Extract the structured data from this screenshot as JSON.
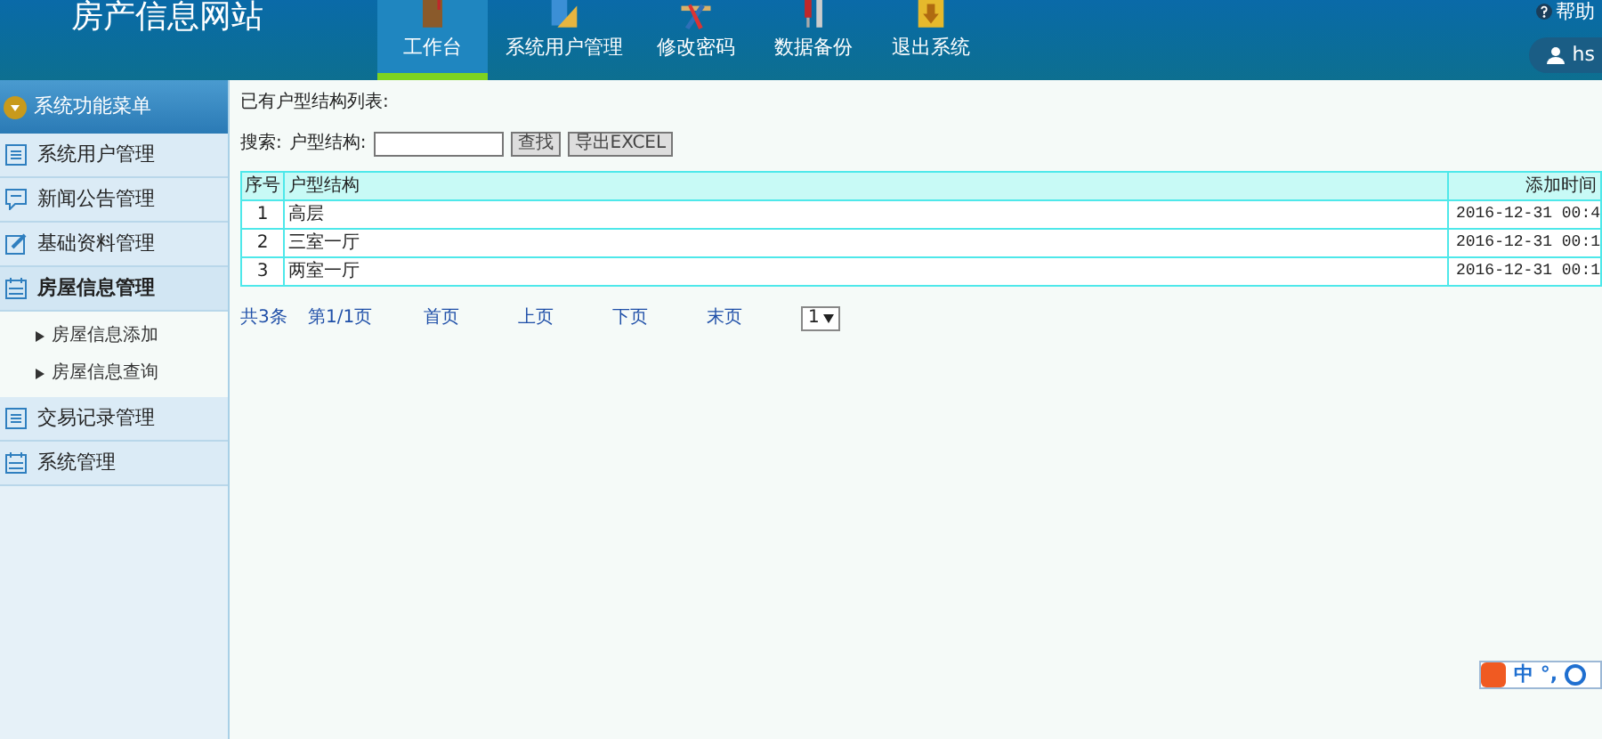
{
  "header": {
    "title": "房产信息网站",
    "help": "帮助",
    "user": "hs",
    "nav": [
      {
        "label": "工作台",
        "selected": true
      },
      {
        "label": "系统用户管理",
        "selected": false
      },
      {
        "label": "修改密码",
        "selected": false
      },
      {
        "label": "数据备份",
        "selected": false
      },
      {
        "label": "退出系统",
        "selected": false
      }
    ]
  },
  "sidebar": {
    "title": "系统功能菜单",
    "groups": [
      {
        "label": "系统用户管理",
        "expanded": false
      },
      {
        "label": "新闻公告管理",
        "expanded": false
      },
      {
        "label": "基础资料管理",
        "expanded": false
      },
      {
        "label": "房屋信息管理",
        "expanded": true,
        "children": [
          {
            "label": "房屋信息添加"
          },
          {
            "label": "房屋信息查询"
          }
        ]
      },
      {
        "label": "交易记录管理",
        "expanded": false
      },
      {
        "label": "系统管理",
        "expanded": false
      }
    ]
  },
  "content": {
    "caption": "已有户型结构列表:",
    "search_label": "搜索:",
    "field_label": "户型结构:",
    "buttons": [
      "查找",
      "导出EXCEL"
    ],
    "columns": [
      "序号",
      "户型结构",
      "添加时间"
    ],
    "rows": [
      [
        "1",
        "高层",
        "2016-12-31 00:4"
      ],
      [
        "2",
        "三室一厅",
        "2016-12-31 00:1"
      ],
      [
        "3",
        "两室一厅",
        "2016-12-31 00:1"
      ]
    ],
    "pager": {
      "total": "共3条",
      "page": "第1/1页",
      "first": "首页",
      "prev": "上页",
      "next": "下页",
      "last": "末页",
      "select": "1"
    }
  },
  "ime": {
    "mode": "中",
    "punct": "°,"
  }
}
